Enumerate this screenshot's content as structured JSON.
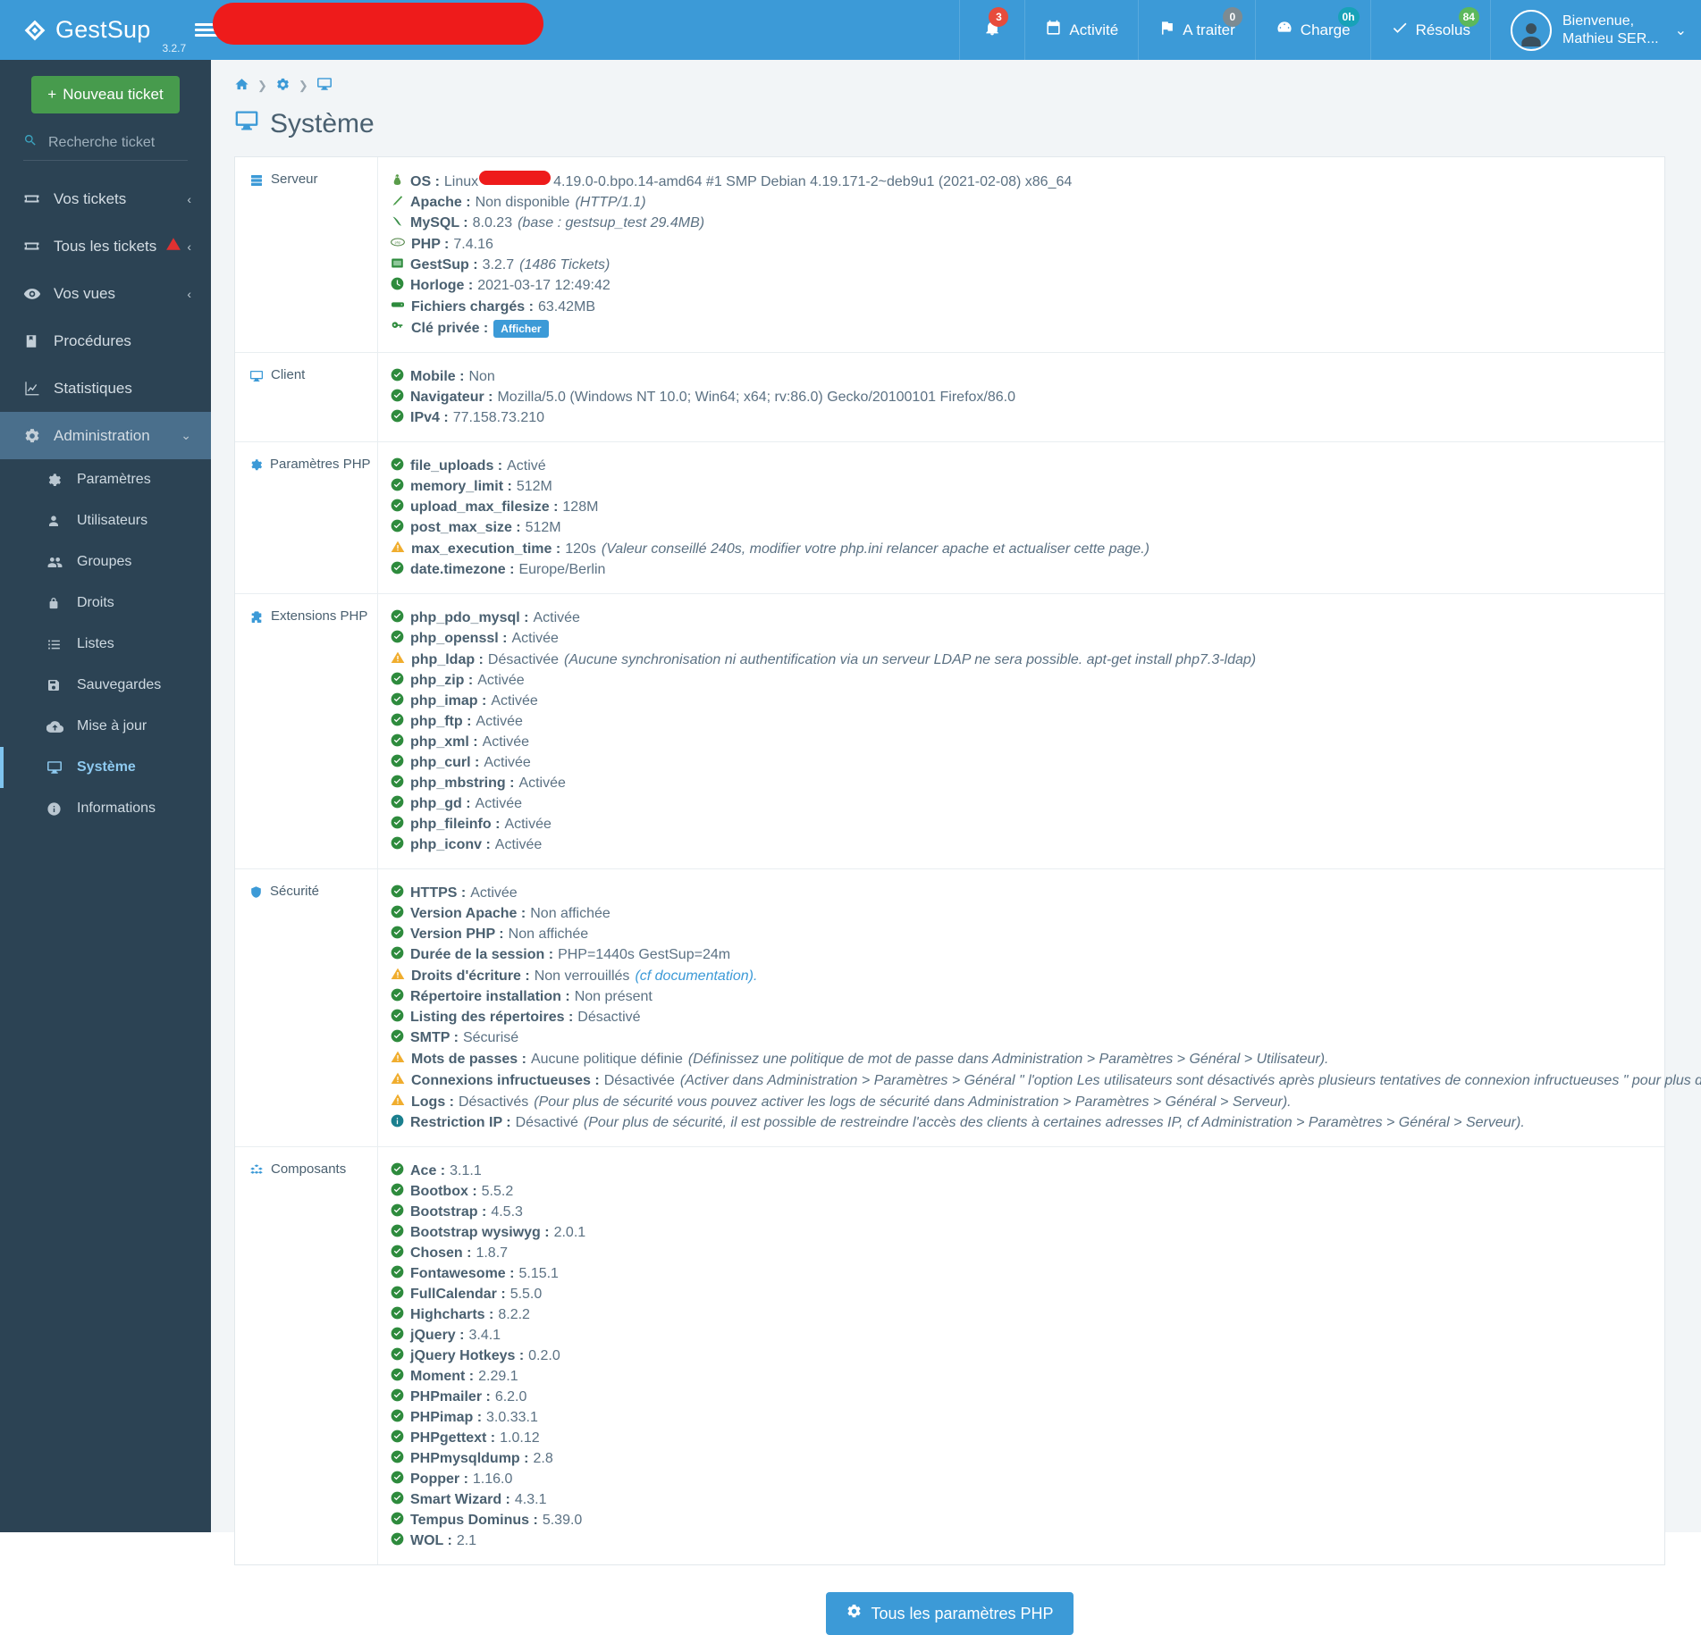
{
  "header": {
    "brand": "GestSup",
    "version": "3.2.7",
    "menu_icon": "hamburger-icon",
    "items": [
      {
        "name": "notifications",
        "label": "",
        "icon": "bell-icon",
        "badge": "3",
        "badge_color": "#e74c3c"
      },
      {
        "name": "activite",
        "label": "Activité",
        "icon": "calendar-icon",
        "badge": "",
        "badge_color": ""
      },
      {
        "name": "a-traiter",
        "label": "A traiter",
        "icon": "flag-icon",
        "badge": "0",
        "badge_color": "#7d8b92"
      },
      {
        "name": "charge",
        "label": "Charge",
        "icon": "gauge-icon",
        "badge": "0h",
        "badge_color": "#17a2b8"
      },
      {
        "name": "resolus",
        "label": "Résolus",
        "icon": "check-icon",
        "badge": "84",
        "badge_color": "#5cb85c"
      }
    ],
    "user": {
      "greeting": "Bienvenue,",
      "name": "Mathieu SER..."
    }
  },
  "sidebar": {
    "new_ticket": "Nouveau ticket",
    "search_placeholder": "Recherche ticket",
    "search_value": "",
    "items": [
      {
        "label": "Vos tickets",
        "icon": "ticket-icon",
        "chevron": "‹",
        "warning": false
      },
      {
        "label": "Tous les tickets",
        "icon": "ticket-icon",
        "chevron": "‹",
        "warning": true
      },
      {
        "label": "Vos vues",
        "icon": "eye-icon",
        "chevron": "‹",
        "warning": false
      },
      {
        "label": "Procédures",
        "icon": "book-icon",
        "chevron": "",
        "warning": false
      },
      {
        "label": "Statistiques",
        "icon": "chart-icon",
        "chevron": "",
        "warning": false
      },
      {
        "label": "Administration",
        "icon": "gears-icon",
        "chevron": "⌄",
        "warning": false
      }
    ],
    "sub_items": [
      {
        "label": "Paramètres",
        "icon": "gear-icon"
      },
      {
        "label": "Utilisateurs",
        "icon": "user-icon"
      },
      {
        "label": "Groupes",
        "icon": "users-icon"
      },
      {
        "label": "Droits",
        "icon": "lock-icon"
      },
      {
        "label": "Listes",
        "icon": "list-icon"
      },
      {
        "label": "Sauvegardes",
        "icon": "save-icon"
      },
      {
        "label": "Mise à jour",
        "icon": "cloud-upload-icon"
      },
      {
        "label": "Système",
        "icon": "desktop-icon"
      },
      {
        "label": "Informations",
        "icon": "info-icon"
      }
    ],
    "current_sub": "Système"
  },
  "breadcrumb": [
    "home-icon",
    "gears-icon",
    "desktop-icon"
  ],
  "page": {
    "title": "Système",
    "icon": "desktop-icon"
  },
  "sections": [
    {
      "label": "Serveur",
      "icon": "server-icon",
      "rows": [
        {
          "status": "linux-icon",
          "label": "OS :",
          "value": "Linux",
          "redacted": true,
          "value2": "4.19.0-0.bpo.14-amd64 #1 SMP Debian 4.19.171-2~deb9u1 (2021-02-08) x86_64",
          "note": ""
        },
        {
          "status": "apache-icon",
          "label": "Apache :",
          "value": "Non disponible",
          "note": "(HTTP/1.1)"
        },
        {
          "status": "mysql-icon",
          "label": "MySQL :",
          "value": "8.0.23",
          "note": "(base : gestsup_test 29.4MB)"
        },
        {
          "status": "php-icon",
          "label": "PHP :",
          "value": "7.4.16",
          "note": ""
        },
        {
          "status": "gestsup-icon",
          "label": "GestSup :",
          "value": "3.2.7",
          "note": "(1486 Tickets)"
        },
        {
          "status": "clock-icon",
          "label": "Horloge :",
          "value": "2021-03-17 12:49:42",
          "note": ""
        },
        {
          "status": "hdd-icon",
          "label": "Fichiers chargés :",
          "value": "63.42MB",
          "note": ""
        },
        {
          "status": "key-icon",
          "label": "Clé privée :",
          "value": "",
          "button": "Afficher",
          "note": ""
        }
      ]
    },
    {
      "label": "Client",
      "icon": "desktop-icon",
      "rows": [
        {
          "status": "ok",
          "label": "Mobile :",
          "value": "Non",
          "note": ""
        },
        {
          "status": "ok",
          "label": "Navigateur :",
          "value": "Mozilla/5.0 (Windows NT 10.0; Win64; x64; rv:86.0) Gecko/20100101 Firefox/86.0",
          "note": ""
        },
        {
          "status": "ok",
          "label": "IPv4 :",
          "value": "77.158.73.210",
          "note": ""
        }
      ]
    },
    {
      "label": "Paramètres PHP",
      "icon": "gear-icon",
      "rows": [
        {
          "status": "ok",
          "label": "file_uploads :",
          "value": "Activé",
          "note": ""
        },
        {
          "status": "ok",
          "label": "memory_limit :",
          "value": "512M",
          "note": ""
        },
        {
          "status": "ok",
          "label": "upload_max_filesize :",
          "value": "128M",
          "note": ""
        },
        {
          "status": "ok",
          "label": "post_max_size :",
          "value": "512M",
          "note": ""
        },
        {
          "status": "warn",
          "label": "max_execution_time :",
          "value": "120s",
          "note": "(Valeur conseillé 240s, modifier votre php.ini relancer apache et actualiser cette page.)"
        },
        {
          "status": "ok",
          "label": "date.timezone :",
          "value": "Europe/Berlin",
          "note": ""
        }
      ]
    },
    {
      "label": "Extensions PHP",
      "icon": "puzzle-icon",
      "rows": [
        {
          "status": "ok",
          "label": "php_pdo_mysql :",
          "value": "Activée",
          "note": ""
        },
        {
          "status": "ok",
          "label": "php_openssl :",
          "value": "Activée",
          "note": ""
        },
        {
          "status": "warn",
          "label": "php_ldap :",
          "value": "Désactivée",
          "note": "(Aucune synchronisation ni authentification via un serveur LDAP ne sera possible. apt-get install php7.3-ldap)"
        },
        {
          "status": "ok",
          "label": "php_zip :",
          "value": "Activée",
          "note": ""
        },
        {
          "status": "ok",
          "label": "php_imap :",
          "value": "Activée",
          "note": ""
        },
        {
          "status": "ok",
          "label": "php_ftp :",
          "value": "Activée",
          "note": ""
        },
        {
          "status": "ok",
          "label": "php_xml :",
          "value": "Activée",
          "note": ""
        },
        {
          "status": "ok",
          "label": "php_curl :",
          "value": "Activée",
          "note": ""
        },
        {
          "status": "ok",
          "label": "php_mbstring :",
          "value": "Activée",
          "note": ""
        },
        {
          "status": "ok",
          "label": "php_gd :",
          "value": "Activée",
          "note": ""
        },
        {
          "status": "ok",
          "label": "php_fileinfo :",
          "value": "Activée",
          "note": ""
        },
        {
          "status": "ok",
          "label": "php_iconv :",
          "value": "Activée",
          "note": ""
        }
      ]
    },
    {
      "label": "Sécurité",
      "icon": "shield-icon",
      "rows": [
        {
          "status": "ok",
          "label": "HTTPS :",
          "value": "Activée",
          "note": ""
        },
        {
          "status": "ok",
          "label": "Version Apache :",
          "value": "Non affichée",
          "note": ""
        },
        {
          "status": "ok",
          "label": "Version PHP :",
          "value": "Non affichée",
          "note": ""
        },
        {
          "status": "ok",
          "label": "Durée de la session :",
          "value": "PHP=1440s GestSup=24m",
          "note": ""
        },
        {
          "status": "warn",
          "label": "Droits d'écriture :",
          "value": "Non verrouillés",
          "note": "(cf documentation).",
          "note_link": true
        },
        {
          "status": "ok",
          "label": "Répertoire installation :",
          "value": "Non présent",
          "note": ""
        },
        {
          "status": "ok",
          "label": "Listing des répertoires :",
          "value": "Désactivé",
          "note": ""
        },
        {
          "status": "ok",
          "label": "SMTP :",
          "value": "Sécurisé",
          "note": ""
        },
        {
          "status": "warn",
          "label": "Mots de passes :",
          "value": "Aucune politique définie",
          "note": "(Définissez une politique de mot de passe dans Administration > Paramètres > Général > Utilisateur)."
        },
        {
          "status": "warn",
          "label": "Connexions infructueuses :",
          "value": "Désactivée",
          "note": "(Activer dans Administration > Paramètres > Général \" l'option Les utilisateurs sont désactivés après plusieurs tentatives de connexion infructueuses \" pour plus de sécurité)."
        },
        {
          "status": "warn",
          "label": "Logs :",
          "value": "Désactivés",
          "note": "(Pour plus de sécurité vous pouvez activer les logs de sécurité dans Administration > Paramètres > Général > Serveur)."
        },
        {
          "status": "info",
          "label": "Restriction IP :",
          "value": "Désactivé",
          "note": "(Pour plus de sécurité, il est possible de restreindre l'accès des clients à certaines adresses IP, cf Administration > Paramètres > Général > Serveur)."
        }
      ]
    },
    {
      "label": "Composants",
      "icon": "cubes-icon",
      "rows": [
        {
          "status": "ok",
          "label": "Ace :",
          "value": "3.1.1",
          "note": ""
        },
        {
          "status": "ok",
          "label": "Bootbox :",
          "value": "5.5.2",
          "note": ""
        },
        {
          "status": "ok",
          "label": "Bootstrap :",
          "value": "4.5.3",
          "note": ""
        },
        {
          "status": "ok",
          "label": "Bootstrap wysiwyg :",
          "value": "2.0.1",
          "note": ""
        },
        {
          "status": "ok",
          "label": "Chosen :",
          "value": "1.8.7",
          "note": ""
        },
        {
          "status": "ok",
          "label": "Fontawesome :",
          "value": "5.15.1",
          "note": ""
        },
        {
          "status": "ok",
          "label": "FullCalendar :",
          "value": "5.5.0",
          "note": ""
        },
        {
          "status": "ok",
          "label": "Highcharts :",
          "value": "8.2.2",
          "note": ""
        },
        {
          "status": "ok",
          "label": "jQuery :",
          "value": "3.4.1",
          "note": ""
        },
        {
          "status": "ok",
          "label": "jQuery Hotkeys :",
          "value": "0.2.0",
          "note": ""
        },
        {
          "status": "ok",
          "label": "Moment :",
          "value": "2.29.1",
          "note": ""
        },
        {
          "status": "ok",
          "label": "PHPmailer :",
          "value": "6.2.0",
          "note": ""
        },
        {
          "status": "ok",
          "label": "PHPimap :",
          "value": "3.0.33.1",
          "note": ""
        },
        {
          "status": "ok",
          "label": "PHPgettext :",
          "value": "1.0.12",
          "note": ""
        },
        {
          "status": "ok",
          "label": "PHPmysqldump :",
          "value": "2.8",
          "note": ""
        },
        {
          "status": "ok",
          "label": "Popper :",
          "value": "1.16.0",
          "note": ""
        },
        {
          "status": "ok",
          "label": "Smart Wizard :",
          "value": "4.3.1",
          "note": ""
        },
        {
          "status": "ok",
          "label": "Tempus Dominus :",
          "value": "5.39.0",
          "note": ""
        },
        {
          "status": "ok",
          "label": "WOL :",
          "value": "2.1",
          "note": ""
        }
      ]
    }
  ],
  "footer": {
    "button": "Tous les paramètres PHP",
    "icon": "gears-icon"
  },
  "colors": {
    "brand_blue": "#3c9ad7",
    "sidebar_dark": "#2c4354",
    "green": "#2e8b3d",
    "warning": "#f0ad2e",
    "redaction": "#ee1b1b"
  }
}
